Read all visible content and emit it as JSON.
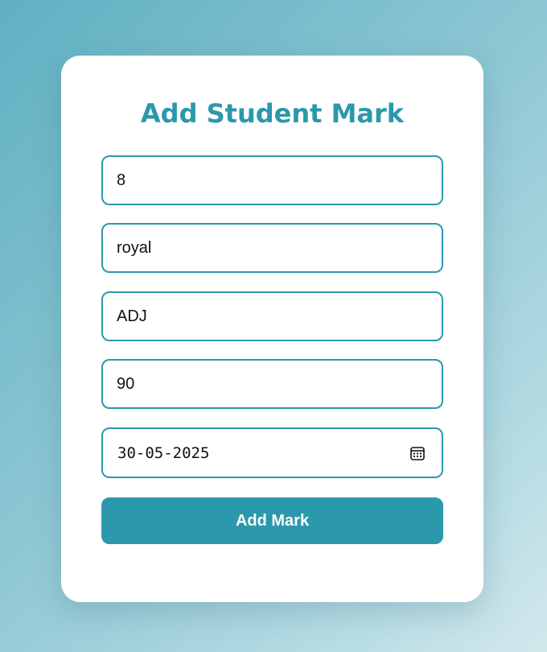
{
  "form": {
    "title": "Add Student Mark",
    "fields": [
      {
        "value": "8"
      },
      {
        "value": "royal"
      },
      {
        "value": "ADJ"
      },
      {
        "value": "90"
      },
      {
        "value": "30-05-2025",
        "icon": "calendar-icon"
      }
    ],
    "submit_label": "Add Mark"
  },
  "colors": {
    "accent": "#2b98ab",
    "card": "#ffffff",
    "background_start": "#5fb0c2",
    "background_end": "#d2e8ec"
  }
}
